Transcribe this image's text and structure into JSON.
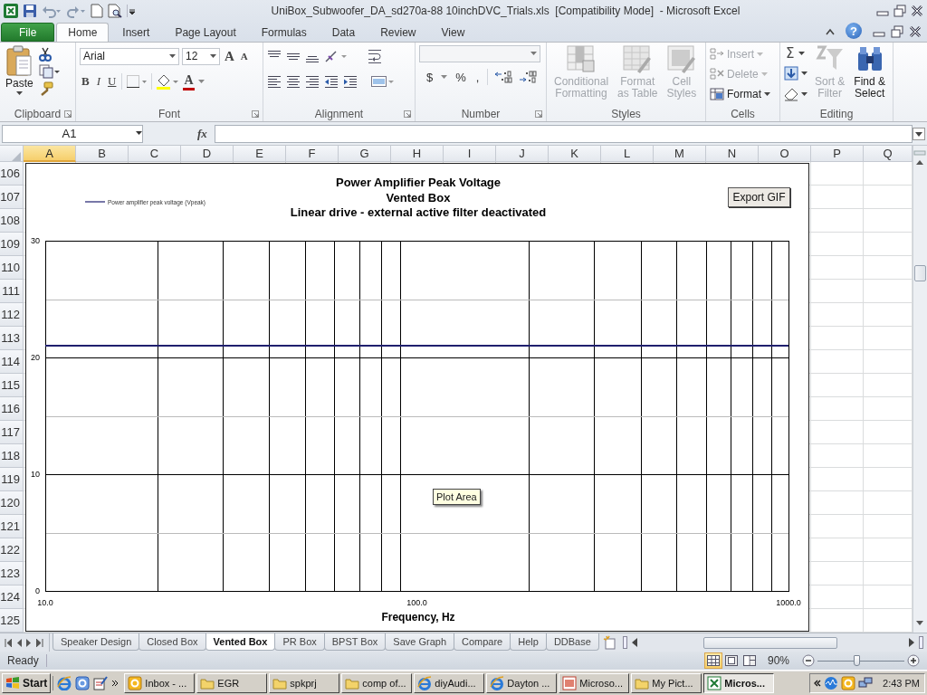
{
  "window": {
    "title": "UniBox_Subwoofer_DA_sd270a-88 10inchDVC_Trials.xls  [Compatibility Mode]  - Microsoft Excel",
    "help": "?"
  },
  "ribbon_tabs": [
    {
      "label": "File",
      "kind": "file",
      "selected": false
    },
    {
      "label": "Home",
      "kind": "tab",
      "selected": true
    },
    {
      "label": "Insert",
      "kind": "tab",
      "selected": false
    },
    {
      "label": "Page Layout",
      "kind": "tab",
      "selected": false
    },
    {
      "label": "Formulas",
      "kind": "tab",
      "selected": false
    },
    {
      "label": "Data",
      "kind": "tab",
      "selected": false
    },
    {
      "label": "Review",
      "kind": "tab",
      "selected": false
    },
    {
      "label": "View",
      "kind": "tab",
      "selected": false
    }
  ],
  "ribbon_groups": [
    {
      "label": "Clipboard",
      "buttons": [
        {
          "label": "Paste",
          "disabled": false
        }
      ]
    },
    {
      "label": "Font",
      "font_name": "Arial",
      "font_size": "12",
      "size_buttons": [
        "A",
        "A"
      ],
      "style_buttons": [
        "B",
        "I",
        "U"
      ],
      "font_color": "A"
    },
    {
      "label": "Alignment"
    },
    {
      "label": "Number",
      "symbols": [
        "$",
        "%",
        ","
      ]
    },
    {
      "label": "Styles",
      "buttons": [
        {
          "label": "Conditional\nFormatting",
          "disabled": true
        },
        {
          "label": "Format\nas Table",
          "disabled": true
        },
        {
          "label": "Cell\nStyles",
          "disabled": true
        }
      ]
    },
    {
      "label": "Cells",
      "buttons": [
        {
          "label": "Insert",
          "disabled": true
        },
        {
          "label": "Delete",
          "disabled": true
        },
        {
          "label": "Format",
          "disabled": false
        }
      ]
    },
    {
      "label": "Editing",
      "sum": "Σ",
      "buttons": [
        {
          "label": "Sort &\nFilter",
          "disabled": true
        },
        {
          "label": "Find &\nSelect",
          "disabled": false
        }
      ]
    }
  ],
  "formula_bar": {
    "name_box": "A1",
    "function_label": "fx"
  },
  "columns": [
    {
      "label": "A",
      "selected": true
    },
    {
      "label": "B",
      "selected": false
    },
    {
      "label": "C",
      "selected": false
    },
    {
      "label": "D",
      "selected": false
    },
    {
      "label": "E",
      "selected": false
    },
    {
      "label": "F",
      "selected": false
    },
    {
      "label": "G",
      "selected": false
    },
    {
      "label": "H",
      "selected": false
    },
    {
      "label": "I",
      "selected": false
    },
    {
      "label": "J",
      "selected": false
    },
    {
      "label": "K",
      "selected": false
    },
    {
      "label": "L",
      "selected": false
    },
    {
      "label": "M",
      "selected": false
    },
    {
      "label": "N",
      "selected": false
    },
    {
      "label": "O",
      "selected": false
    },
    {
      "label": "P",
      "selected": false
    },
    {
      "label": "Q",
      "selected": false
    }
  ],
  "rows": [
    "106",
    "107",
    "108",
    "109",
    "110",
    "111",
    "112",
    "113",
    "114",
    "115",
    "116",
    "117",
    "118",
    "119",
    "120",
    "121",
    "122",
    "123",
    "124",
    "125"
  ],
  "chart": {
    "subtitle_lines": [
      "Vented Box",
      "Linear drive - external active filter deactivated"
    ],
    "export_button": "Export GIF",
    "tooltip": "Plot Area",
    "chart_data": {
      "type": "line",
      "title": "Power Amplifier Peak Voltage",
      "xlabel": "Frequency, Hz",
      "categories": [
        "10.0",
        "100.0",
        "1000.0"
      ],
      "series": [
        {
          "name": "Power amplifier peak voltage (Vpeak)",
          "color": "#1f1f6e",
          "values": [
            21,
            21,
            21
          ]
        }
      ],
      "ylim": [
        0,
        30
      ],
      "yticks": [
        0,
        10,
        20,
        30
      ]
    }
  },
  "sheet_tabs": [
    {
      "label": "Speaker Design",
      "selected": false
    },
    {
      "label": "Closed Box",
      "selected": false
    },
    {
      "label": "Vented Box",
      "selected": true
    },
    {
      "label": "PR Box",
      "selected": false
    },
    {
      "label": "BPST Box",
      "selected": false
    },
    {
      "label": "Save Graph",
      "selected": false
    },
    {
      "label": "Compare",
      "selected": false
    },
    {
      "label": "Help",
      "selected": false
    },
    {
      "label": "DDBase",
      "selected": false
    }
  ],
  "status_bar": {
    "status": "Ready",
    "views": [
      {
        "kind": "normal",
        "selected": true
      },
      {
        "kind": "page-layout",
        "selected": false
      },
      {
        "kind": "page-break",
        "selected": false
      }
    ],
    "zoom": "90%",
    "zoom_slider": {
      "level": 0.45
    }
  },
  "taskbar": {
    "start": "Start",
    "items": [
      {
        "label": "Inbox - ...",
        "kind": "mail",
        "selected": false
      },
      {
        "label": "EGR",
        "kind": "folder",
        "selected": false
      },
      {
        "label": "spkprj",
        "kind": "folder",
        "selected": false
      },
      {
        "label": "comp of...",
        "kind": "folder",
        "selected": false
      },
      {
        "label": "diyAudi...",
        "kind": "browser",
        "selected": false
      },
      {
        "label": "Dayton ...",
        "kind": "browser",
        "selected": false
      },
      {
        "label": "Microso...",
        "kind": "presentation",
        "selected": false
      },
      {
        "label": "My Pict...",
        "kind": "folder",
        "selected": false
      },
      {
        "label": "Micros...",
        "kind": "spreadsheet",
        "selected": true
      }
    ],
    "clock": "2:43 PM"
  }
}
